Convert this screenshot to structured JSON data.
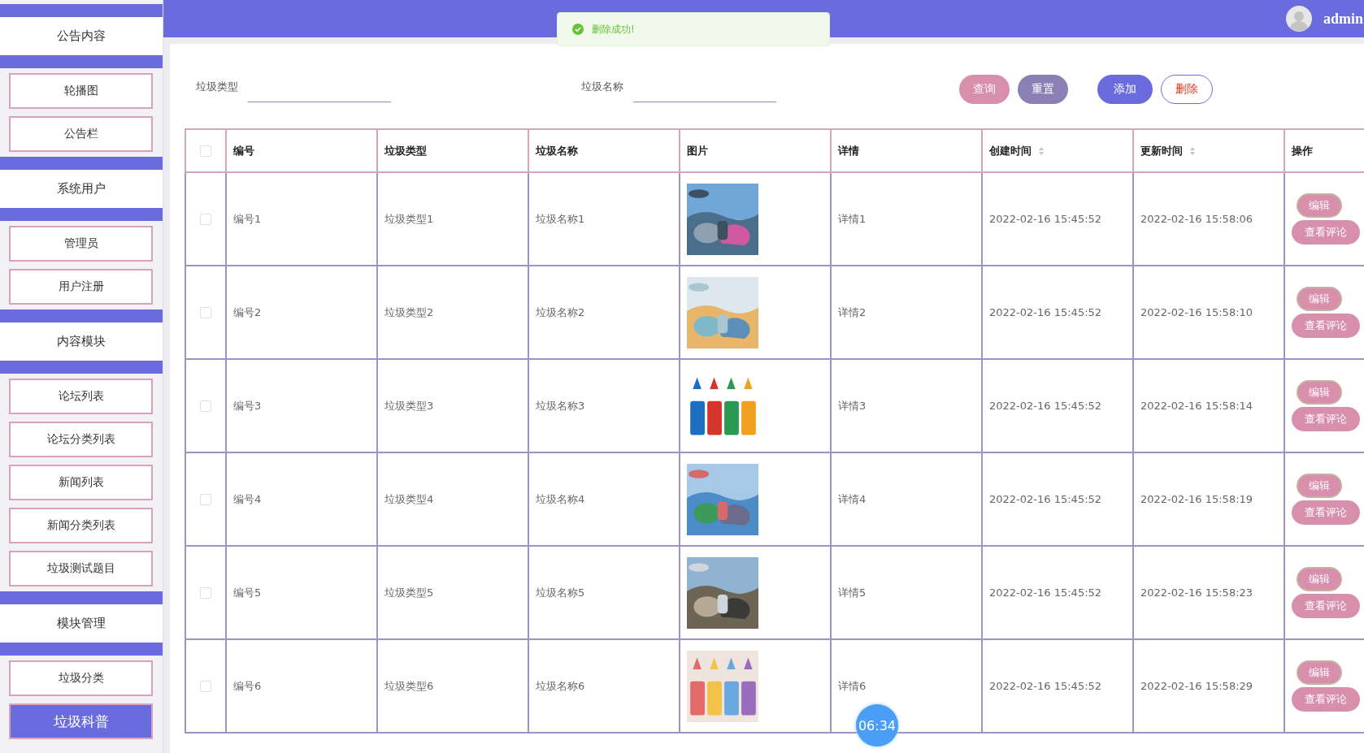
{
  "header": {
    "user": "admin"
  },
  "toast": {
    "message": "删除成功!"
  },
  "sidebar": {
    "groups": [
      {
        "title": "公告内容",
        "items": [
          {
            "label": "轮播图",
            "selected": false
          },
          {
            "label": "公告栏",
            "selected": false
          }
        ]
      },
      {
        "title": "系统用户",
        "items": [
          {
            "label": "管理员",
            "selected": false
          },
          {
            "label": "用户注册",
            "selected": false
          }
        ]
      },
      {
        "title": "内容模块",
        "items": [
          {
            "label": "论坛列表",
            "selected": false
          },
          {
            "label": "论坛分类列表",
            "selected": false
          },
          {
            "label": "新闻列表",
            "selected": false
          },
          {
            "label": "新闻分类列表",
            "selected": false
          },
          {
            "label": "垃圾测试题目",
            "selected": false
          }
        ]
      },
      {
        "title": "模块管理",
        "items": [
          {
            "label": "垃圾分类",
            "selected": false
          },
          {
            "label": "垃圾科普",
            "selected": true
          }
        ]
      }
    ]
  },
  "filters": [
    {
      "label": "垃圾类型"
    },
    {
      "label": "垃圾名称"
    }
  ],
  "buttons": [
    {
      "kind": "query",
      "label": "查询"
    },
    {
      "kind": "reset",
      "label": "重置"
    },
    {
      "kind": "add",
      "label": "添加"
    },
    {
      "kind": "delete",
      "label": "删除"
    }
  ],
  "table": {
    "select_all": {
      "checked": false
    },
    "columns": [
      {
        "label": "编号",
        "sortable": false
      },
      {
        "label": "垃圾类型",
        "sortable": false
      },
      {
        "label": "垃圾名称",
        "sortable": false
      },
      {
        "label": "图片",
        "sortable": false
      },
      {
        "label": "详情",
        "sortable": false
      },
      {
        "label": "创建时间",
        "sortable": true
      },
      {
        "label": "更新时间",
        "sortable": true
      },
      {
        "label": "操作",
        "sortable": false
      }
    ],
    "rows": [
      {
        "checked": false,
        "id": "编号1",
        "type": "垃圾类型1",
        "name": "垃圾名称1",
        "detail": "详情1",
        "created": "2022-02-16 15:45:52",
        "updated": "2022-02-16 15:58:06",
        "actions": [
          "编辑",
          "查看评论"
        ]
      },
      {
        "checked": false,
        "id": "编号2",
        "type": "垃圾类型2",
        "name": "垃圾名称2",
        "detail": "详情2",
        "created": "2022-02-16 15:45:52",
        "updated": "2022-02-16 15:58:10",
        "actions": [
          "编辑",
          "查看评论"
        ]
      },
      {
        "checked": false,
        "id": "编号3",
        "type": "垃圾类型3",
        "name": "垃圾名称3",
        "detail": "详情3",
        "created": "2022-02-16 15:45:52",
        "updated": "2022-02-16 15:58:14",
        "actions": [
          "编辑",
          "查看评论"
        ]
      },
      {
        "checked": false,
        "id": "编号4",
        "type": "垃圾类型4",
        "name": "垃圾名称4",
        "detail": "详情4",
        "created": "2022-02-16 15:45:52",
        "updated": "2022-02-16 15:58:19",
        "actions": [
          "编辑",
          "查看评论"
        ]
      },
      {
        "checked": false,
        "id": "编号5",
        "type": "垃圾类型5",
        "name": "垃圾名称5",
        "detail": "详情5",
        "created": "2022-02-16 15:45:52",
        "updated": "2022-02-16 15:58:23",
        "actions": [
          "编辑",
          "查看评论"
        ]
      },
      {
        "checked": false,
        "id": "编号6",
        "type": "垃圾类型6",
        "name": "垃圾名称6",
        "detail": "详情6",
        "created": "2022-02-16 15:45:52",
        "updated": "2022-02-16 15:58:29",
        "actions": [
          "编辑",
          "查看评论"
        ]
      }
    ]
  },
  "timer": {
    "label": "06:34"
  }
}
